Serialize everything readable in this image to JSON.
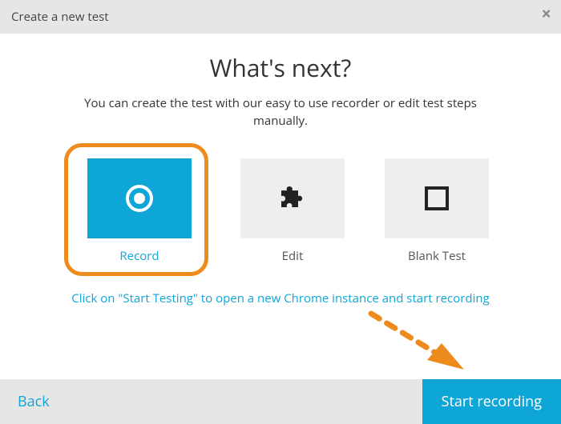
{
  "dialog": {
    "title": "Create a new test",
    "close_label": "×"
  },
  "heading": "What's next?",
  "subheading": "You can create the test with our easy to use recorder or edit test steps manually.",
  "options": {
    "record": {
      "label": "Record",
      "icon": "record-icon"
    },
    "edit": {
      "label": "Edit",
      "icon": "puzzle-icon"
    },
    "blank": {
      "label": "Blank Test",
      "icon": "square-icon"
    }
  },
  "hint": "Click on \"Start Testing\" to open a new Chrome instance and start recording",
  "footer": {
    "back_label": "Back",
    "start_label": "Start recording"
  },
  "colors": {
    "accent": "#0ea6d6",
    "highlight": "#ed8b1c",
    "panel": "#e6e6e6"
  }
}
